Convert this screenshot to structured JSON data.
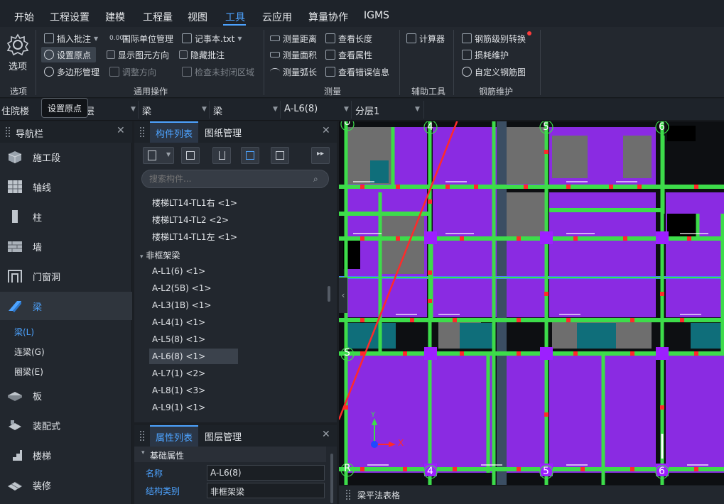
{
  "menu": {
    "items": [
      "开始",
      "工程设置",
      "建模",
      "工程量",
      "视图",
      "工具",
      "云应用",
      "算量协作",
      "IGMS"
    ],
    "active": "工具"
  },
  "ribbon": {
    "options_label": "选项",
    "options_group": "选项",
    "general": {
      "insert_note": "插入批注",
      "intl_units": "国际单位管理",
      "notepad": "记事本.txt",
      "set_origin": "设置原点",
      "show_direction": "显示图元方向",
      "hide_note": "隐藏批注",
      "polygon_mgmt": "多边形管理",
      "adjust_direction": "调整方向",
      "check_unclosed": "检查未封闭区域",
      "group_label": "通用操作"
    },
    "measure": {
      "distance": "测量距离",
      "area": "测量面积",
      "arc": "测量弧长",
      "view_length": "查看长度",
      "view_props": "查看属性",
      "view_errors": "查看错误信息",
      "group_label": "测量"
    },
    "aux": {
      "calculator": "计算器",
      "group_label": "辅助工具"
    },
    "rebar": {
      "grade_convert": "钢筋级别转换",
      "loss_maint": "损耗维护",
      "custom_rebar": "自定义钢筋图",
      "group_label": "钢筋维护"
    }
  },
  "tooltip": "设置原点",
  "filterbar": {
    "floor": "住院楼",
    "layer_suffix": "层",
    "type1": "梁",
    "type2": "梁",
    "component": "A-L6(8)",
    "sublayer": "分层1"
  },
  "nav": {
    "title": "导航栏",
    "items": [
      "施工段",
      "轴线",
      "柱",
      "墙",
      "门窗洞",
      "梁",
      "板",
      "装配式",
      "楼梯",
      "装修"
    ],
    "active": "梁",
    "sub_items": [
      "梁(L)",
      "连梁(G)",
      "圈梁(E)"
    ],
    "active_sub": "梁(L)"
  },
  "components": {
    "tabs": [
      "构件列表",
      "图纸管理"
    ],
    "active_tab": "构件列表",
    "search_placeholder": "搜索构件...",
    "items_top": [
      "楼梯LT14-TL1右 <1>",
      "楼梯LT14-TL2 <2>",
      "楼梯LT14-TL1左 <1>"
    ],
    "group": "非框架梁",
    "items": [
      "A-L1(6) <1>",
      "A-L2(5B) <1>",
      "A-L3(1B) <1>",
      "A-L4(1) <1>",
      "A-L5(8) <1>",
      "A-L6(8) <1>",
      "A-L7(1) <2>",
      "A-L8(1) <3>",
      "A-L9(1) <1>"
    ],
    "selected": "A-L6(8) <1>"
  },
  "properties": {
    "tabs": [
      "属性列表",
      "图层管理"
    ],
    "active_tab": "属性列表",
    "section": "基础属性",
    "rows": [
      {
        "key": "名称",
        "value": "A-L6(8)"
      },
      {
        "key": "结构类别",
        "value": "非框架梁"
      }
    ]
  },
  "canvas": {
    "axis_top": [
      "4",
      "5",
      "6"
    ],
    "axis_bottom": [
      "4",
      "5",
      "6"
    ],
    "axis_left": [
      "U",
      "S",
      "R"
    ],
    "x_label": "X",
    "y_label": "Y"
  },
  "bottom_panel": {
    "title": "梁平法表格"
  },
  "colors": {
    "accent": "#4da3ff",
    "beam_green": "#3ddc4a",
    "slab_purple": "#8a2be2",
    "annotation_red": "#ff2a2a"
  }
}
